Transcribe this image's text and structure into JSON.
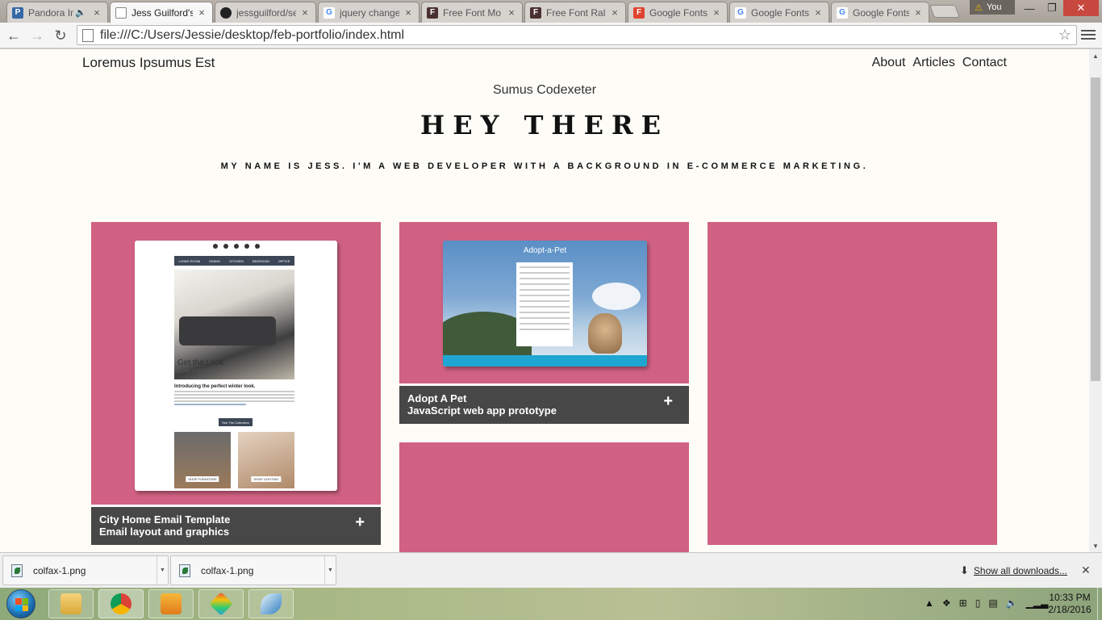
{
  "browser": {
    "tabs": [
      {
        "title": "Pandora In",
        "icon": "pandora-icon",
        "color": "#3668a6",
        "glyph": "P"
      },
      {
        "title": "Jess Guilford's",
        "icon": "page-icon",
        "color": "#ffffff",
        "glyph": ""
      },
      {
        "title": "jessguilford/se",
        "icon": "github-icon",
        "color": "#222222",
        "glyph": "●"
      },
      {
        "title": "jquery change",
        "icon": "google-icon",
        "color": "#4285f4",
        "glyph": "G"
      },
      {
        "title": "Free Font Mo",
        "icon": "fontsquirrel-icon",
        "color": "#4a3030",
        "glyph": "F"
      },
      {
        "title": "Free Font Ral",
        "icon": "fontsquirrel-icon",
        "color": "#4a3030",
        "glyph": "F"
      },
      {
        "title": "Google Fonts",
        "icon": "google-fonts-icon",
        "color": "#e0432d",
        "glyph": "F"
      },
      {
        "title": "Google Fonts",
        "icon": "google-icon",
        "color": "#4285f4",
        "glyph": "G"
      },
      {
        "title": "Google Fonts",
        "icon": "google-icon",
        "color": "#4285f4",
        "glyph": "G"
      }
    ],
    "user_label": "You",
    "address": "file:///C:/Users/Jessie/desktop/feb-portfolio/index.html"
  },
  "site": {
    "brand": "Loremus Ipsumus Est",
    "nav": [
      "About",
      "Articles",
      "Contact"
    ],
    "subtitle": "Sumus Codexeter",
    "hero": "HEY THERE",
    "tagline": "My name is Jess. I'm a web developer with a background in e-commerce marketing.",
    "accent_color": "#d06182",
    "caption_color": "#474747",
    "projects": [
      {
        "title": "City Home Email Template",
        "subtitle": "Email layout and graphics"
      },
      {
        "title": "Adopt A Pet",
        "subtitle": "JavaScript web app prototype"
      }
    ],
    "email_mockup": {
      "nav": [
        "LIVING ROOM",
        "DINING",
        "KITCHEN",
        "BEDROOM",
        "OFFICE"
      ],
      "heading": "Get the Look",
      "subheading": "Cozy Industrial",
      "intro": "Introducing the perfect winter look.",
      "cta": "See The Collection",
      "products": [
        "SHOP FURNITURE",
        "SHOP LIGHTING"
      ]
    },
    "pet_mockup": {
      "title": "Adopt-a-Pet"
    }
  },
  "downloads": {
    "items": [
      "colfax-1.png",
      "colfax-1.png"
    ],
    "show_all": "Show all downloads..."
  },
  "taskbar": {
    "time": "10:33 PM",
    "date": "2/18/2016"
  }
}
